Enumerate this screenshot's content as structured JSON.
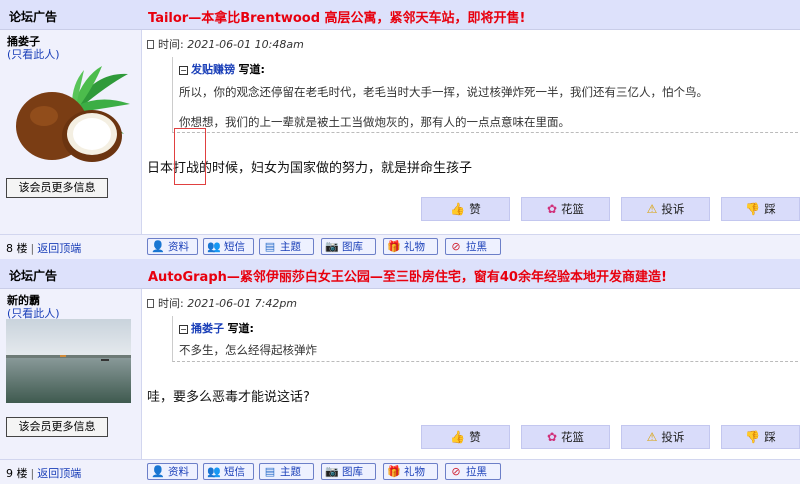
{
  "posts": [
    {
      "ad": {
        "label": "论坛广告",
        "text": "Tailor—本拿比Brentwood 高层公寓，紧邻天车站，即将开售!"
      },
      "user": {
        "name": "捅娄子",
        "only_this": "(只看此人)",
        "avatar": "coconut-avatar",
        "more_info": "该会员更多信息"
      },
      "meta": {
        "label": "时间: ",
        "time": "2021-06-01 10:48am"
      },
      "quote": {
        "user": "发贴赚镑",
        "wrote": "写道:",
        "lines": [
          "所以，你的观念还停留在老毛时代，老毛当时大手一挥，说过核弹炸死一半，我们还有三亿人，怕个鸟。",
          "你想想，我们的上一辈就是被土工当做炮灰的，那有人的一点点意味在里面。"
        ]
      },
      "content": "日本打战的时候，妇女为国家做的努力，就是拼命生孩子",
      "actions": [
        "赞",
        "花篮",
        "投诉",
        "踩"
      ],
      "floor": "8 楼",
      "back_top": "返回顶端",
      "tools": [
        "资料",
        "短信",
        "主题",
        "图库",
        "礼物",
        "拉黑"
      ]
    },
    {
      "ad": {
        "label": "论坛广告",
        "text": "AutoGraph—紧邻伊丽莎白女王公园—至三卧房住宅，窗有40余年经验本地开发商建造!"
      },
      "user": {
        "name": "新的霸",
        "only_this": "(只看此人)",
        "avatar": "seascape-avatar",
        "more_info": "该会员更多信息"
      },
      "meta": {
        "label": "时间: ",
        "time": "2021-06-01 7:42pm"
      },
      "quote": {
        "user": "捅娄子",
        "wrote": "写道:",
        "lines": [
          "不多生，怎么经得起核弹炸"
        ]
      },
      "content": "哇，要多么恶毒才能说这话?",
      "actions": [
        "赞",
        "花篮",
        "投诉",
        "踩"
      ],
      "floor": "9 楼",
      "back_top": "返回顶端",
      "tools": [
        "资料",
        "短信",
        "主题",
        "图库",
        "礼物",
        "拉黑"
      ]
    }
  ],
  "colors": {
    "ad_text": "#e8000e",
    "link_blue": "#1a3fb8",
    "row_bg": "#dde1fb",
    "sidebar_bg": "#f0f1fc",
    "button_bg": "#d9dcfa"
  }
}
